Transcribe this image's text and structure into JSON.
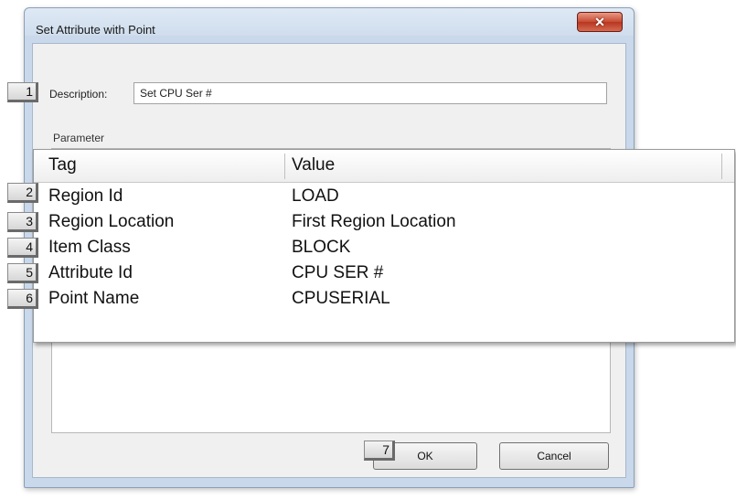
{
  "window": {
    "title": "Set Attribute with Point",
    "close_symbol": "✕"
  },
  "description": {
    "label": "Description:",
    "value": "Set CPU Ser #"
  },
  "parameter": {
    "label": "Parameter",
    "columns": [
      "Tag",
      "Value"
    ],
    "rows": [
      {
        "tag": "Region Id",
        "value": "LOAD",
        "badge": "2"
      },
      {
        "tag": "Region Location",
        "value": "First Region Location",
        "badge": "3"
      },
      {
        "tag": "Item Class",
        "value": "BLOCK",
        "badge": "4"
      },
      {
        "tag": "Attribute Id",
        "value": "CPU SER #",
        "badge": "5"
      },
      {
        "tag": "Point Name",
        "value": "CPUSERIAL",
        "badge": "6"
      }
    ]
  },
  "buttons": {
    "ok": "OK",
    "cancel": "Cancel"
  },
  "badges": {
    "description": "1",
    "ok": "7"
  },
  "colors": {
    "close_button": "#c74a33",
    "title_bar": "#cfdded"
  }
}
